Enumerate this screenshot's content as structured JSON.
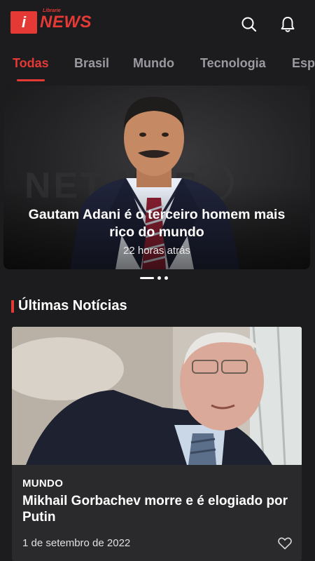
{
  "header": {
    "logo_glyph": "i",
    "logo_small": "Librarie",
    "logo_news": "NEWS",
    "icons": [
      "search-icon",
      "bell-icon"
    ]
  },
  "tabs": [
    {
      "label": "Todas",
      "active": true
    },
    {
      "label": "Brasil",
      "active": false
    },
    {
      "label": "Mundo",
      "active": false
    },
    {
      "label": "Tecnologia",
      "active": false
    },
    {
      "label": "Esp",
      "active": false
    }
  ],
  "hero": {
    "title": "Gautam Adani é o terceiro homem mais rico do mundo",
    "time": "22 horas atrás",
    "slide_count": 3,
    "active_slide": 1
  },
  "latest": {
    "section_title": "Últimas Notícias",
    "card": {
      "category": "MUNDO",
      "title": "Mikhail Gorbachev morre e é elogiado por Putin",
      "date": "1 de setembro de 2022",
      "icon": "heart-icon"
    }
  },
  "colors": {
    "accent": "#e53935",
    "background": "#1c1c1e",
    "card": "#2a2a2c",
    "tab_inactive": "#9a9aa0"
  }
}
